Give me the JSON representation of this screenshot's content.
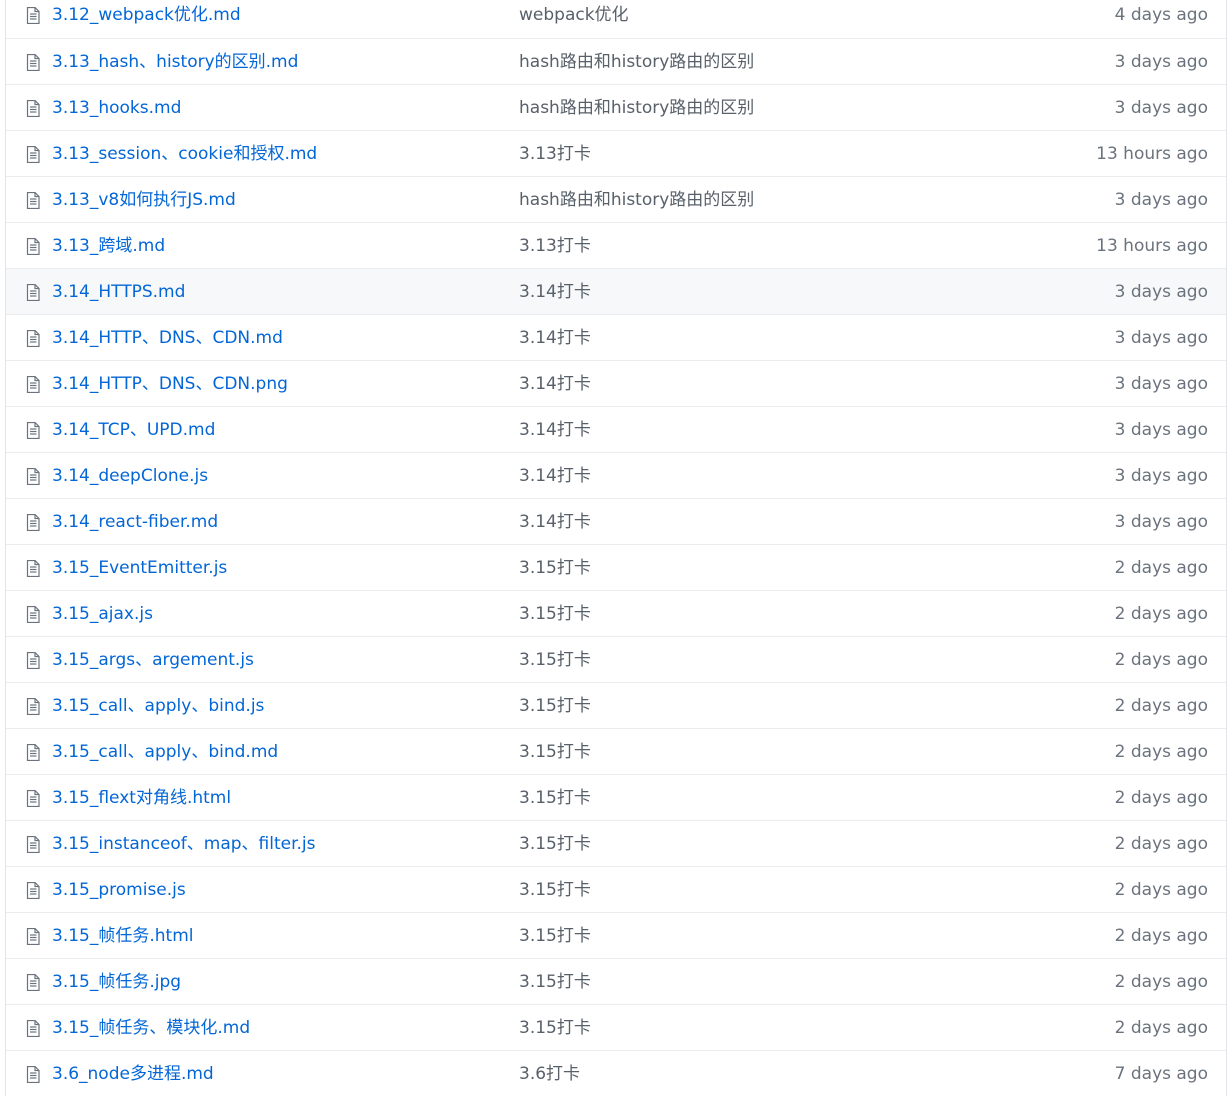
{
  "colors": {
    "link": "#0366d6",
    "message": "#586069",
    "age": "#6a737d",
    "border": "#eaecef",
    "hover": "#f6f8fa"
  },
  "file_icon": "file-text-icon",
  "files": [
    {
      "name": "3.12_webpack优化.md",
      "message": "webpack优化",
      "age": "4 days ago"
    },
    {
      "name": "3.13_hash、history的区别.md",
      "message": "hash路由和history路由的区别",
      "age": "3 days ago"
    },
    {
      "name": "3.13_hooks.md",
      "message": "hash路由和history路由的区别",
      "age": "3 days ago"
    },
    {
      "name": "3.13_session、cookie和授权.md",
      "message": "3.13打卡",
      "age": "13 hours ago"
    },
    {
      "name": "3.13_v8如何执行JS.md",
      "message": "hash路由和history路由的区别",
      "age": "3 days ago"
    },
    {
      "name": "3.13_跨域.md",
      "message": "3.13打卡",
      "age": "13 hours ago"
    },
    {
      "name": "3.14_HTTPS.md",
      "message": "3.14打卡",
      "age": "3 days ago"
    },
    {
      "name": "3.14_HTTP、DNS、CDN.md",
      "message": "3.14打卡",
      "age": "3 days ago"
    },
    {
      "name": "3.14_HTTP、DNS、CDN.png",
      "message": "3.14打卡",
      "age": "3 days ago"
    },
    {
      "name": "3.14_TCP、UPD.md",
      "message": "3.14打卡",
      "age": "3 days ago"
    },
    {
      "name": "3.14_deepClone.js",
      "message": "3.14打卡",
      "age": "3 days ago"
    },
    {
      "name": "3.14_react-fiber.md",
      "message": "3.14打卡",
      "age": "3 days ago"
    },
    {
      "name": "3.15_EventEmitter.js",
      "message": "3.15打卡",
      "age": "2 days ago"
    },
    {
      "name": "3.15_ajax.js",
      "message": "3.15打卡",
      "age": "2 days ago"
    },
    {
      "name": "3.15_args、argement.js",
      "message": "3.15打卡",
      "age": "2 days ago"
    },
    {
      "name": "3.15_call、apply、bind.js",
      "message": "3.15打卡",
      "age": "2 days ago"
    },
    {
      "name": "3.15_call、apply、bind.md",
      "message": "3.15打卡",
      "age": "2 days ago"
    },
    {
      "name": "3.15_flext对角线.html",
      "message": "3.15打卡",
      "age": "2 days ago"
    },
    {
      "name": "3.15_instanceof、map、filter.js",
      "message": "3.15打卡",
      "age": "2 days ago"
    },
    {
      "name": "3.15_promise.js",
      "message": "3.15打卡",
      "age": "2 days ago"
    },
    {
      "name": "3.15_帧任务.html",
      "message": "3.15打卡",
      "age": "2 days ago"
    },
    {
      "name": "3.15_帧任务.jpg",
      "message": "3.15打卡",
      "age": "2 days ago"
    },
    {
      "name": "3.15_帧任务、模块化.md",
      "message": "3.15打卡",
      "age": "2 days ago"
    },
    {
      "name": "3.6_node多进程.md",
      "message": "3.6打卡",
      "age": "7 days ago"
    }
  ]
}
